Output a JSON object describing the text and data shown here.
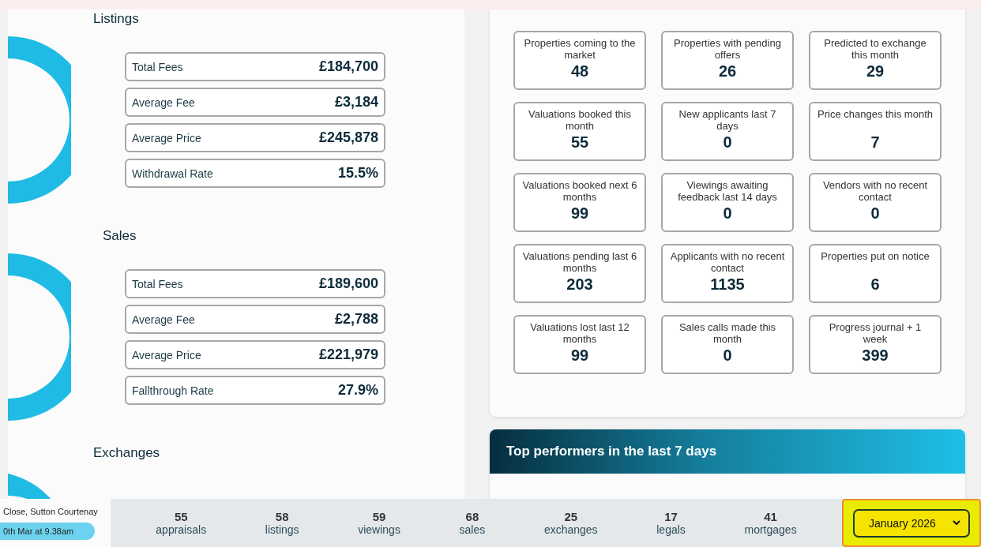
{
  "sections": [
    {
      "title": "Listings",
      "stats": [
        {
          "label": "Total Fees",
          "value": "£184,700"
        },
        {
          "label": "Average Fee",
          "value": "£3,184"
        },
        {
          "label": "Average Price",
          "value": "£245,878"
        },
        {
          "label": "Withdrawal Rate",
          "value": "15.5%"
        }
      ]
    },
    {
      "title": "Sales",
      "stats": [
        {
          "label": "Total Fees",
          "value": "£189,600"
        },
        {
          "label": "Average Fee",
          "value": "£2,788"
        },
        {
          "label": "Average Price",
          "value": "£221,979"
        },
        {
          "label": "Fallthrough Rate",
          "value": "27.9%"
        }
      ]
    },
    {
      "title": "Exchanges"
    }
  ],
  "kpis": [
    {
      "label": "Properties coming to the market",
      "value": "48"
    },
    {
      "label": "Properties with pending offers",
      "value": "26"
    },
    {
      "label": "Predicted to exchange this month",
      "value": "29"
    },
    {
      "label": "Valuations booked this month",
      "value": "55"
    },
    {
      "label": "New applicants last 7 days",
      "value": "0"
    },
    {
      "label": "Price changes this month",
      "value": "7"
    },
    {
      "label": "Valuations booked next 6 months",
      "value": "99"
    },
    {
      "label": "Viewings awaiting feedback last 14 days",
      "value": "0"
    },
    {
      "label": "Vendors with no recent contact",
      "value": "0"
    },
    {
      "label": "Valuations pending last 6 months",
      "value": "203"
    },
    {
      "label": "Applicants with no recent contact",
      "value": "1135"
    },
    {
      "label": "Properties put on notice",
      "value": "6"
    },
    {
      "label": "Valuations lost last 12 months",
      "value": "99"
    },
    {
      "label": "Sales calls made this month",
      "value": "0"
    },
    {
      "label": "Progress journal + 1 week",
      "value": "399"
    }
  ],
  "top_performers": {
    "title": "Top performers in the last 7 days"
  },
  "footer": {
    "address": "Close, Sutton Courtenay",
    "time": "0th Mar at 9.38am",
    "stats": [
      {
        "value": "55",
        "label": "appraisals"
      },
      {
        "value": "58",
        "label": "listings"
      },
      {
        "value": "59",
        "label": "viewings"
      },
      {
        "value": "68",
        "label": "sales"
      },
      {
        "value": "25",
        "label": "exchanges"
      },
      {
        "value": "17",
        "label": "legals"
      },
      {
        "value": "41",
        "label": "mortgages"
      }
    ],
    "month_select": {
      "value": "January 2026"
    }
  }
}
